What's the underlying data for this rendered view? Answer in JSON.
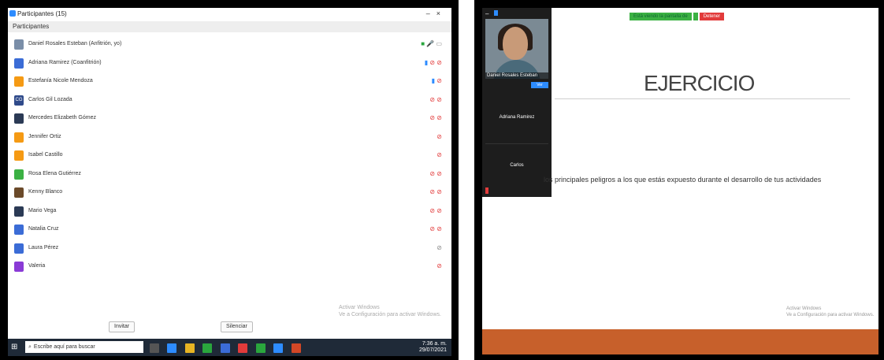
{
  "left": {
    "window": {
      "title": "Participantes (15)",
      "subtitle": "Participantes"
    },
    "participants": [
      {
        "initials": "",
        "name": "Daniel Rosales Esteban (Anfitrión, yo)",
        "color": "#7a8ea8",
        "icons": [
          "ic-green:■",
          "ic-gray:🎤",
          "ic-gray:▭"
        ]
      },
      {
        "initials": "",
        "name": "Adriana Ramirez (Coanfitrión)",
        "color": "#3b6cd6",
        "icons": [
          "ic-blue:▮",
          "ic-cam:⊘",
          "ic-mic:⊘"
        ]
      },
      {
        "initials": "",
        "name": "Estefanía Nicole Mendoza",
        "color": "#f59a14",
        "icons": [
          "ic-blue:▮",
          "ic-mic:⊘"
        ]
      },
      {
        "initials": "CG",
        "name": "Carlos Gil Lozada",
        "color": "#2f4a8a",
        "icons": [
          "ic-cam:⊘",
          "ic-mic:⊘"
        ]
      },
      {
        "initials": "",
        "name": "Mercedes Elizabeth Gómez",
        "color": "#2b3a55",
        "icons": [
          "ic-cam:⊘",
          "ic-mic:⊘"
        ]
      },
      {
        "initials": "",
        "name": "Jennifer Ortiz",
        "color": "#f59a14",
        "icons": [
          "ic-mic:⊘"
        ]
      },
      {
        "initials": "",
        "name": "Isabel Castillo",
        "color": "#f59a14",
        "icons": [
          "ic-mic:⊘"
        ]
      },
      {
        "initials": "",
        "name": "Rosa Elena Gutiérrez",
        "color": "#3bb143",
        "icons": [
          "ic-cam:⊘",
          "ic-mic:⊘"
        ]
      },
      {
        "initials": "",
        "name": "Kenny Blanco",
        "color": "#6b4a2a",
        "icons": [
          "ic-cam:⊘",
          "ic-mic:⊘"
        ]
      },
      {
        "initials": "",
        "name": "Mario Vega",
        "color": "#2b3a55",
        "icons": [
          "ic-cam:⊘",
          "ic-mic:⊘"
        ]
      },
      {
        "initials": "",
        "name": "Natalia Cruz",
        "color": "#3b6cd6",
        "icons": [
          "ic-cam:⊘",
          "ic-mic:⊘"
        ]
      },
      {
        "initials": "",
        "name": "Laura Pérez",
        "color": "#3b6cd6",
        "icons": [
          "ic-gray:⊘"
        ]
      },
      {
        "initials": "",
        "name": "Valeria",
        "color": "#8a3bd6",
        "icons": [
          "ic-mic:⊘"
        ]
      }
    ],
    "footer": {
      "invite_label": "Invitar",
      "mute_all_label": "Silenciar"
    },
    "activate_line1": "Activar Windows",
    "activate_line2": "Ve a Configuración para activar Windows.",
    "taskbar": {
      "search_placeholder": "Escribe aquí para buscar",
      "tray_time": "7:36 a. m.",
      "tray_date": "29/07/2021"
    }
  },
  "right": {
    "meeting": {
      "recording_label": "Está viendo la pantalla de",
      "stop_label": "Detener"
    },
    "video": {
      "header": "",
      "main_name": "Daniel Rosales Esteban",
      "button_label": "Ver",
      "tile1_name": "Adriana Ramirez",
      "tile2_name": "Carlos"
    },
    "slide": {
      "title": "EJERCICIO",
      "body": "los principales peligros a los que estás expuesto durante el desarrollo de tus actividades",
      "activate_line1": "Activar Windows",
      "activate_line2": "Ve a Configuración para activar Windows."
    }
  },
  "colors": {
    "accent": "#2d8cff",
    "danger": "#e23b3b",
    "slide_band": "#c7602b"
  }
}
